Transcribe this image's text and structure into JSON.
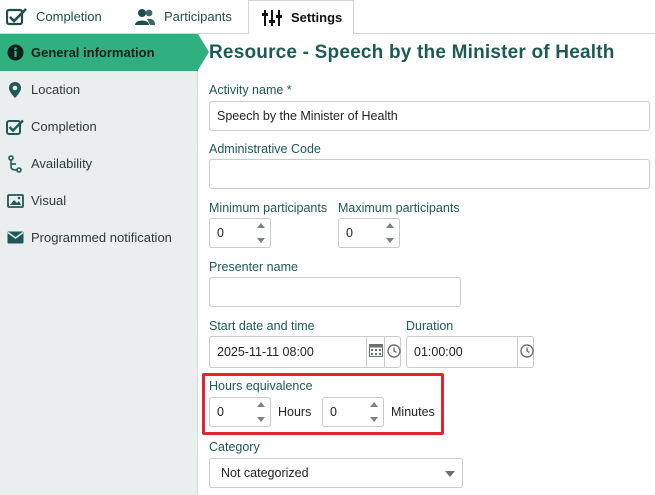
{
  "tabs": [
    {
      "label": "Completion",
      "icon": "checkbox-icon"
    },
    {
      "label": "Participants",
      "icon": "users-icon"
    },
    {
      "label": "Settings",
      "icon": "sliders-icon",
      "active": true
    }
  ],
  "sidebar": {
    "items": [
      {
        "label": "General information",
        "icon": "info-icon",
        "active": true
      },
      {
        "label": "Location",
        "icon": "map-pin-icon"
      },
      {
        "label": "Completion",
        "icon": "checkbox-icon"
      },
      {
        "label": "Availability",
        "icon": "flow-icon"
      },
      {
        "label": "Visual",
        "icon": "image-icon"
      },
      {
        "label": "Programmed notification",
        "icon": "envelope-icon"
      }
    ]
  },
  "main": {
    "title": "Resource - Speech by the Minister of Health",
    "activity_name": {
      "label": "Activity name *",
      "value": "Speech by the Minister of Health"
    },
    "admin_code": {
      "label": "Administrative Code",
      "value": ""
    },
    "min_participants": {
      "label": "Minimum participants",
      "value": "0"
    },
    "max_participants": {
      "label": "Maximum participants",
      "value": "0"
    },
    "presenter_name": {
      "label": "Presenter name",
      "value": ""
    },
    "start_datetime": {
      "label": "Start date and time",
      "value": "2025-11-11 08:00"
    },
    "duration": {
      "label": "Duration",
      "value": "01:00:00"
    },
    "hours_equivalence": {
      "label": "Hours equivalence",
      "hours_value": "0",
      "hours_unit": "Hours",
      "minutes_value": "0",
      "minutes_unit": "Minutes"
    },
    "category": {
      "label": "Category",
      "value": "Not categorized"
    }
  },
  "colors": {
    "accent": "#2fb07e",
    "title": "#1d5a55",
    "highlight": "#e0262b"
  }
}
